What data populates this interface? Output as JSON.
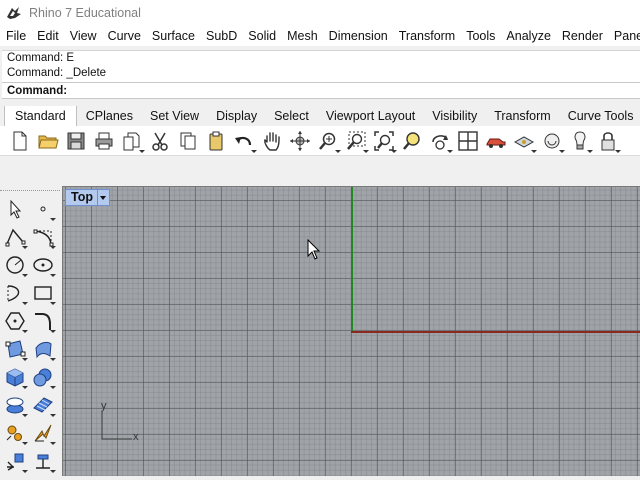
{
  "window": {
    "title": "Rhino 7 Educational"
  },
  "menu": [
    "File",
    "Edit",
    "View",
    "Curve",
    "Surface",
    "SubD",
    "Solid",
    "Mesh",
    "Dimension",
    "Transform",
    "Tools",
    "Analyze",
    "Render",
    "Panels"
  ],
  "command_history": [
    "Command: E",
    "Command: _Delete"
  ],
  "command_prompt": {
    "label": "Command:",
    "value": ""
  },
  "toolbar_tabs": [
    "Standard",
    "CPlanes",
    "Set View",
    "Display",
    "Select",
    "Viewport Layout",
    "Visibility",
    "Transform",
    "Curve Tools"
  ],
  "active_tab": "Standard",
  "standard_toolbar_icons": [
    "new-file-icon",
    "open-folder-icon",
    "save-icon",
    "print-icon",
    "import-icon",
    "cut-icon",
    "copy-icon",
    "paste-icon",
    "undo-icon",
    "pan-icon",
    "rotate-view-icon",
    "zoom-icon",
    "zoom-window-icon",
    "zoom-extents-icon",
    "zoom-selected-icon",
    "rotate-camera-icon",
    "four-viewports-icon",
    "car-render-icon",
    "material-icon",
    "object-properties-icon",
    "light-bulb-icon",
    "lock-icon"
  ],
  "left_toolbar_icons": [
    "select-arrow-icon",
    "point-icon",
    "polyline-icon",
    "control-point-curve-icon",
    "circle-icon",
    "ellipse-icon",
    "arc-icon",
    "rectangle-icon",
    "polygon-icon",
    "fillet-curve-icon",
    "surface-from-points-icon",
    "extrude-surface-icon",
    "box-icon",
    "sphere-icon",
    "cylinder-icon",
    "mesh-plane-icon",
    "transform-gear-icon",
    "explode-icon",
    "boolean-icon",
    "dimension-icon"
  ],
  "viewport": {
    "name": "Top",
    "axis_x_label": "x",
    "axis_y_label": "y"
  },
  "colors": {
    "viewport_bg": "#a0a4a8",
    "axis_x": "#8a2a1f",
    "axis_y": "#1f8a1f",
    "viewport_label_bg": "#b3c9ee"
  }
}
